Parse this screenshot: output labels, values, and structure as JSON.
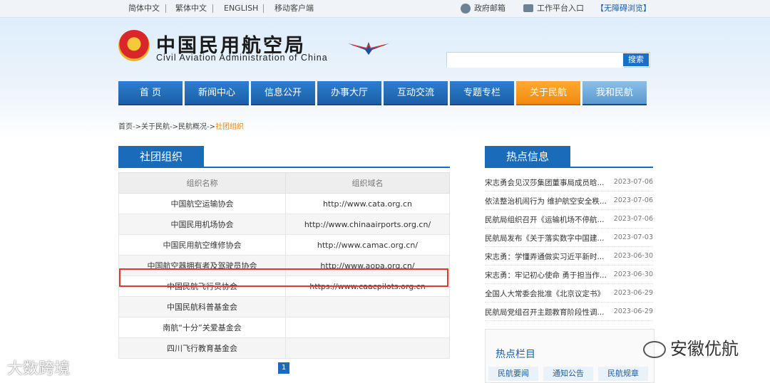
{
  "topbar": {
    "lang_simplified": "简体中文",
    "lang_traditional": "繁体中文",
    "lang_english": "ENGLISH",
    "mobile": "移动客户端",
    "gov_mail": "政府邮箱",
    "work_platform": "工作平台入口",
    "accessibility": "【无障碍浏览】"
  },
  "header": {
    "title_cn": "中国民用航空局",
    "title_en": "Civil Aviation Administration of China",
    "search_placeholder": "",
    "search_button": "搜索"
  },
  "nav": [
    "首 页",
    "新闻中心",
    "信息公开",
    "办事大厅",
    "互动交流",
    "专题专栏",
    "关于民航",
    "我和民航"
  ],
  "breadcrumb": {
    "home": "首页",
    "about": "关于民航",
    "overview": "民航概况",
    "current": "社团组织",
    "sep": "->"
  },
  "orgs": {
    "title": "社团组织",
    "col_name": "组织名称",
    "col_domain": "组织域名",
    "rows": [
      {
        "name": "中国航空运输协会",
        "domain": "http://www.cata.org.cn"
      },
      {
        "name": "中国民用机场协会",
        "domain": "http://www.chinaairports.org.cn/"
      },
      {
        "name": "中国民用航空维修协会",
        "domain": "http://www.camac.org.cn/"
      },
      {
        "name": "中国航空器拥有者及驾驶员协会",
        "domain": "http://www.aopa.org.cn/"
      },
      {
        "name": "中国民航飞行员协会",
        "domain": "https://www.caacpilots.org.cn"
      },
      {
        "name": "中国民航科普基金会",
        "domain": ""
      },
      {
        "name": "南航“十分”关爱基金会",
        "domain": ""
      },
      {
        "name": "四川飞行教育基金会",
        "domain": ""
      }
    ],
    "page": "1"
  },
  "hot": {
    "title": "热点信息",
    "items": [
      {
        "title": "宋志勇会见汉莎集团董事局成员晗...",
        "date": "2023-07-06"
      },
      {
        "title": "依法整治机闹行为 维护航空安全秩...",
        "date": "2023-07-06"
      },
      {
        "title": "民航局组织召开《运输机场不停航...",
        "date": "2023-07-06"
      },
      {
        "title": "民航局发布《关于落实数字中国建...",
        "date": "2023-07-03"
      },
      {
        "title": "宋志勇：学懂弄通做实习近平新时...",
        "date": "2023-06-30"
      },
      {
        "title": "宋志勇：牢记初心使命 勇于担当作...",
        "date": "2023-06-30"
      },
      {
        "title": "全国人大常委会批准《北京议定书》",
        "date": "2023-06-29"
      },
      {
        "title": "民航局党组召开主题教育阶段性调...",
        "date": "2023-06-29"
      }
    ]
  },
  "hot_column": {
    "title": "热点栏目",
    "tags": [
      "民航要闻",
      "通知公告",
      "民航规章"
    ]
  },
  "watermarks": {
    "left": "大数跨境",
    "right": "安徽优航"
  }
}
